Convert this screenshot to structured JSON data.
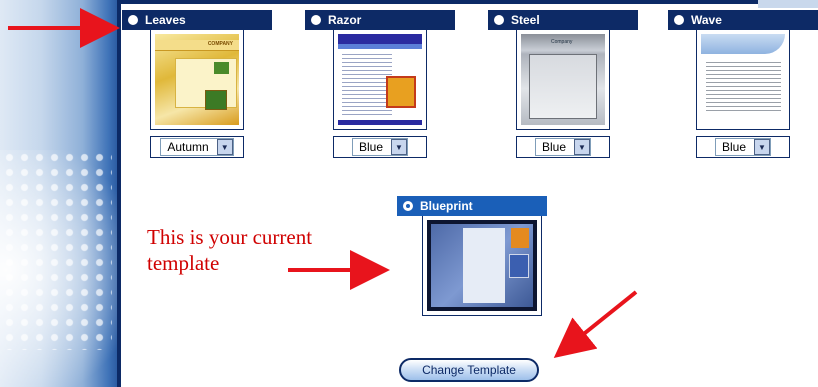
{
  "templates": [
    {
      "name": "Leaves",
      "selected_value": "Autumn",
      "style": "leaves"
    },
    {
      "name": "Razor",
      "selected_value": "Blue",
      "style": "razor"
    },
    {
      "name": "Steel",
      "selected_value": "Blue",
      "style": "steel"
    },
    {
      "name": "Wave",
      "selected_value": "Blue",
      "style": "wave"
    }
  ],
  "current_template": {
    "name": "Blueprint",
    "style": "blueprint"
  },
  "thumbnail_text": {
    "leaves_logo": "COMPANY",
    "steel_label": "Company"
  },
  "annotation": {
    "line1": "This is your current",
    "line2": "template"
  },
  "change_button_label": "Change Template",
  "colors": {
    "header_bg": "#0d2a66",
    "current_header_bg": "#1a5fb8",
    "annotation_red": "#d00000",
    "arrow_red": "#e8141c"
  }
}
